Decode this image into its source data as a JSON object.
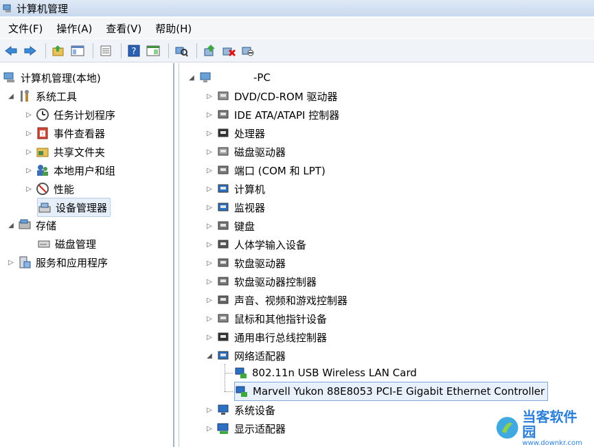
{
  "window": {
    "title": "计算机管理"
  },
  "menubar": {
    "items": [
      "文件(F)",
      "操作(A)",
      "查看(V)",
      "帮助(H)"
    ]
  },
  "left_tree": {
    "root": "计算机管理(本地)",
    "system_tools": "系统工具",
    "task_scheduler": "任务计划程序",
    "event_viewer": "事件查看器",
    "shared_folders": "共享文件夹",
    "local_users": "本地用户和组",
    "performance": "性能",
    "device_manager": "设备管理器",
    "storage": "存储",
    "disk_management": "磁盘管理",
    "services_apps": "服务和应用程序"
  },
  "device_tree": {
    "computer": "-PC",
    "categories": [
      "DVD/CD-ROM 驱动器",
      "IDE ATA/ATAPI 控制器",
      "处理器",
      "磁盘驱动器",
      "端口 (COM 和 LPT)",
      "计算机",
      "监视器",
      "键盘",
      "人体学输入设备",
      "软盘驱动器",
      "软盘驱动器控制器",
      "声音、视频和游戏控制器",
      "鼠标和其他指针设备",
      "通用串行总线控制器",
      "网络适配器"
    ],
    "network_children": [
      "802.11n USB Wireless LAN Card",
      "Marvell Yukon 88E8053 PCI-E Gigabit Ethernet Controller"
    ],
    "after": [
      "系统设备",
      "显示适配器"
    ]
  },
  "watermark": {
    "title": "当客软件园",
    "url": "www.downkr.com"
  },
  "colors": {
    "accent": "#2b7fd9",
    "selection_border": "#7fa7d9"
  }
}
